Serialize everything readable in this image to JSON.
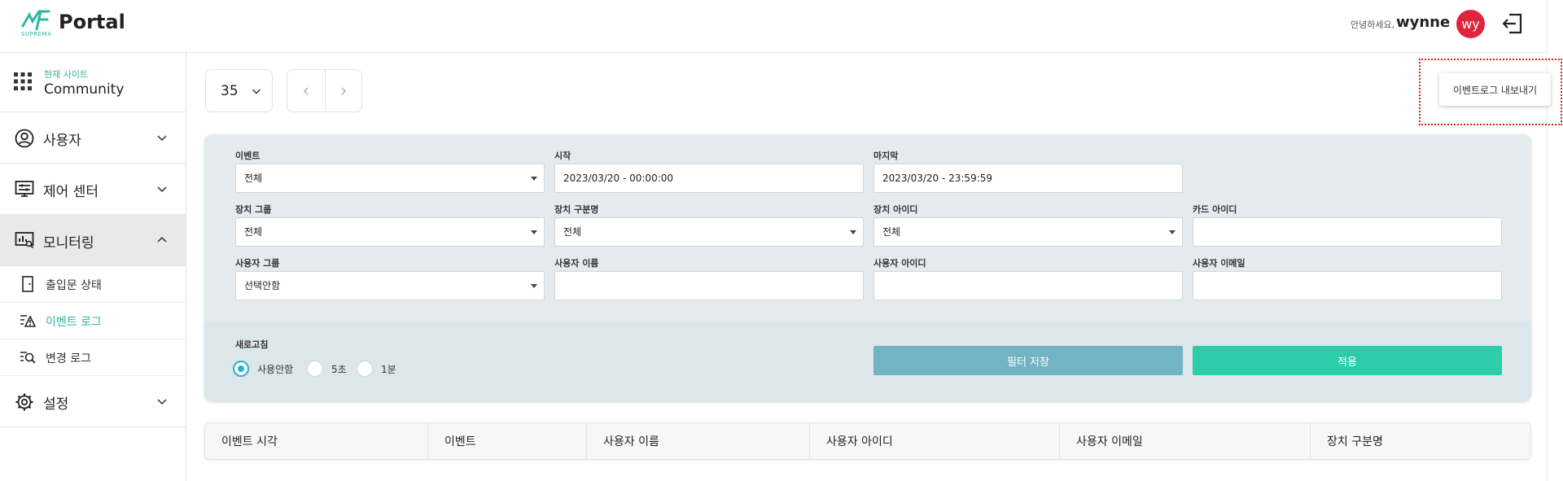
{
  "header": {
    "logo_title": "Portal",
    "logo_sub": "SUPREMA",
    "greeting": "안녕하세요,",
    "username": "wynne",
    "avatar_initials": "wy",
    "brand_color": "#2fb6a0",
    "avatar_color": "#e0243c"
  },
  "sidebar": {
    "site_label": "현재 사이트",
    "site_name": "Community",
    "items": [
      {
        "label": "사용자",
        "icon": "user-icon",
        "expanded": false
      },
      {
        "label": "제어 센터",
        "icon": "control-center-icon",
        "expanded": false
      },
      {
        "label": "모니터링",
        "icon": "monitoring-icon",
        "expanded": true
      },
      {
        "label": "설정",
        "icon": "settings-icon",
        "expanded": false
      }
    ],
    "subitems": [
      {
        "label": "출입문 상태",
        "icon": "door-icon"
      },
      {
        "label": "이벤트 로그",
        "icon": "event-log-icon",
        "current": true
      },
      {
        "label": "변경 로그",
        "icon": "change-log-icon"
      }
    ]
  },
  "toolbar": {
    "page_size": "35",
    "export_label": "이벤트로그 내보내기"
  },
  "filters": {
    "event": {
      "label": "이벤트",
      "value": "전체"
    },
    "start": {
      "label": "시작",
      "value": "2023/03/20 - 00:00:00"
    },
    "end": {
      "label": "마지막",
      "value": "2023/03/20 - 23:59:59"
    },
    "device_group": {
      "label": "장치 그룹",
      "value": "전체"
    },
    "device_type": {
      "label": "장치 구분명",
      "value": "전체"
    },
    "device_id": {
      "label": "장치 아이디",
      "value": "전체"
    },
    "card_id": {
      "label": "카드 아이디",
      "value": ""
    },
    "user_group": {
      "label": "사용자 그룹",
      "value": "선택안함"
    },
    "user_name": {
      "label": "사용자 이름",
      "value": ""
    },
    "user_id": {
      "label": "사용자 아이디",
      "value": ""
    },
    "user_email": {
      "label": "사용자 이메일",
      "value": ""
    },
    "refresh_label": "새로고침",
    "refresh_options": [
      "사용안함",
      "5초",
      "1분"
    ],
    "refresh_selected": "사용안함",
    "save_label": "필터 저장",
    "apply_label": "적용"
  },
  "table": {
    "columns": [
      "이벤트 시각",
      "이벤트",
      "사용자 이름",
      "사용자 아이디",
      "사용자 이메일",
      "장치 구분명"
    ]
  }
}
